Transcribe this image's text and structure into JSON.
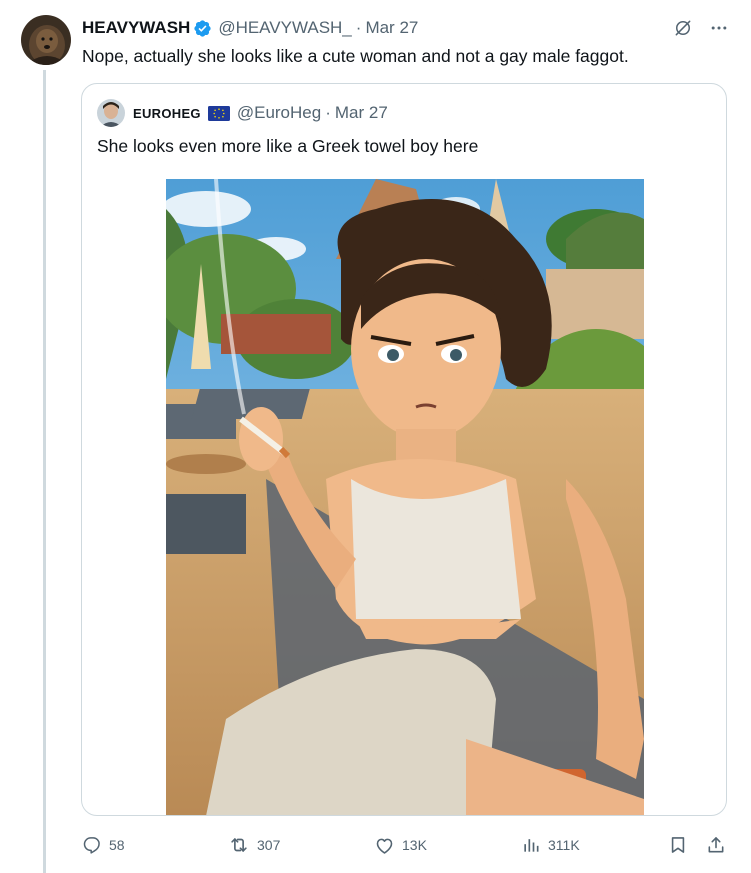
{
  "tweet": {
    "author_name": "HEAVYWASH",
    "handle": "@HEAVYWASH_",
    "separator": "·",
    "date": "Mar 27",
    "text": "Nope, actually she looks like a cute woman and not a gay male faggot.",
    "verified_color": "#1d9bf0"
  },
  "quoted": {
    "author_name": "EUROHEG",
    "handle": "@EuroHeg",
    "separator": "·",
    "date": "Mar 27",
    "text": "She looks even more like a Greek towel boy here"
  },
  "actions": {
    "replies": "58",
    "reposts": "307",
    "likes": "13K",
    "views": "311K"
  },
  "icons": [
    "grok-icon",
    "more-icon",
    "reply-icon",
    "repost-icon",
    "like-icon",
    "views-icon",
    "bookmark-icon",
    "share-icon",
    "verified-badge-icon",
    "eu-flag-icon"
  ],
  "colors": {
    "text": "#0f1419",
    "secondary": "#536471",
    "border": "#cfd9de",
    "accent": "#1d9bf0"
  }
}
